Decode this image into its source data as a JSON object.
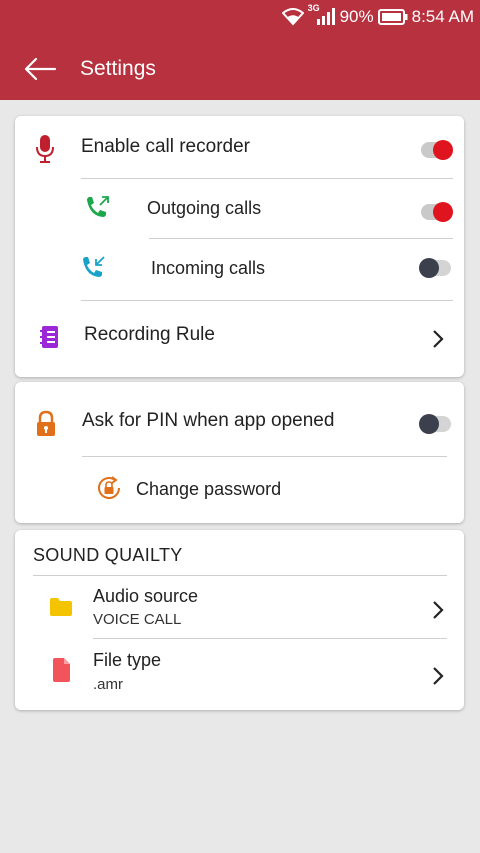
{
  "status": {
    "network": "3G",
    "battery": "90%",
    "time": "8:54 AM"
  },
  "toolbar": {
    "title": "Settings"
  },
  "recorder": {
    "enable_label": "Enable call recorder",
    "enable_on": true,
    "outgoing_label": "Outgoing calls",
    "outgoing_on": true,
    "incoming_label": "Incoming calls",
    "incoming_on": false,
    "rule_label": "Recording Rule"
  },
  "security": {
    "pin_label": "Ask for PIN when app opened",
    "pin_on": false,
    "change_password_label": "Change password"
  },
  "sound": {
    "header": "SOUND QUAILTY",
    "audio_source_label": "Audio source",
    "audio_source_value": "VOICE CALL",
    "file_type_label": "File type",
    "file_type_value": ".amr"
  },
  "colors": {
    "appbar": "#b8313f",
    "switch_on": "#e0141e",
    "switch_off": "#3c3f4c",
    "mic": "#c0202e",
    "outgoing": "#1aa84a",
    "incoming": "#1aa3c9",
    "rule": "#9b27d6",
    "lock": "#e0701a",
    "folder": "#f5c400",
    "file": "#f2545b"
  }
}
